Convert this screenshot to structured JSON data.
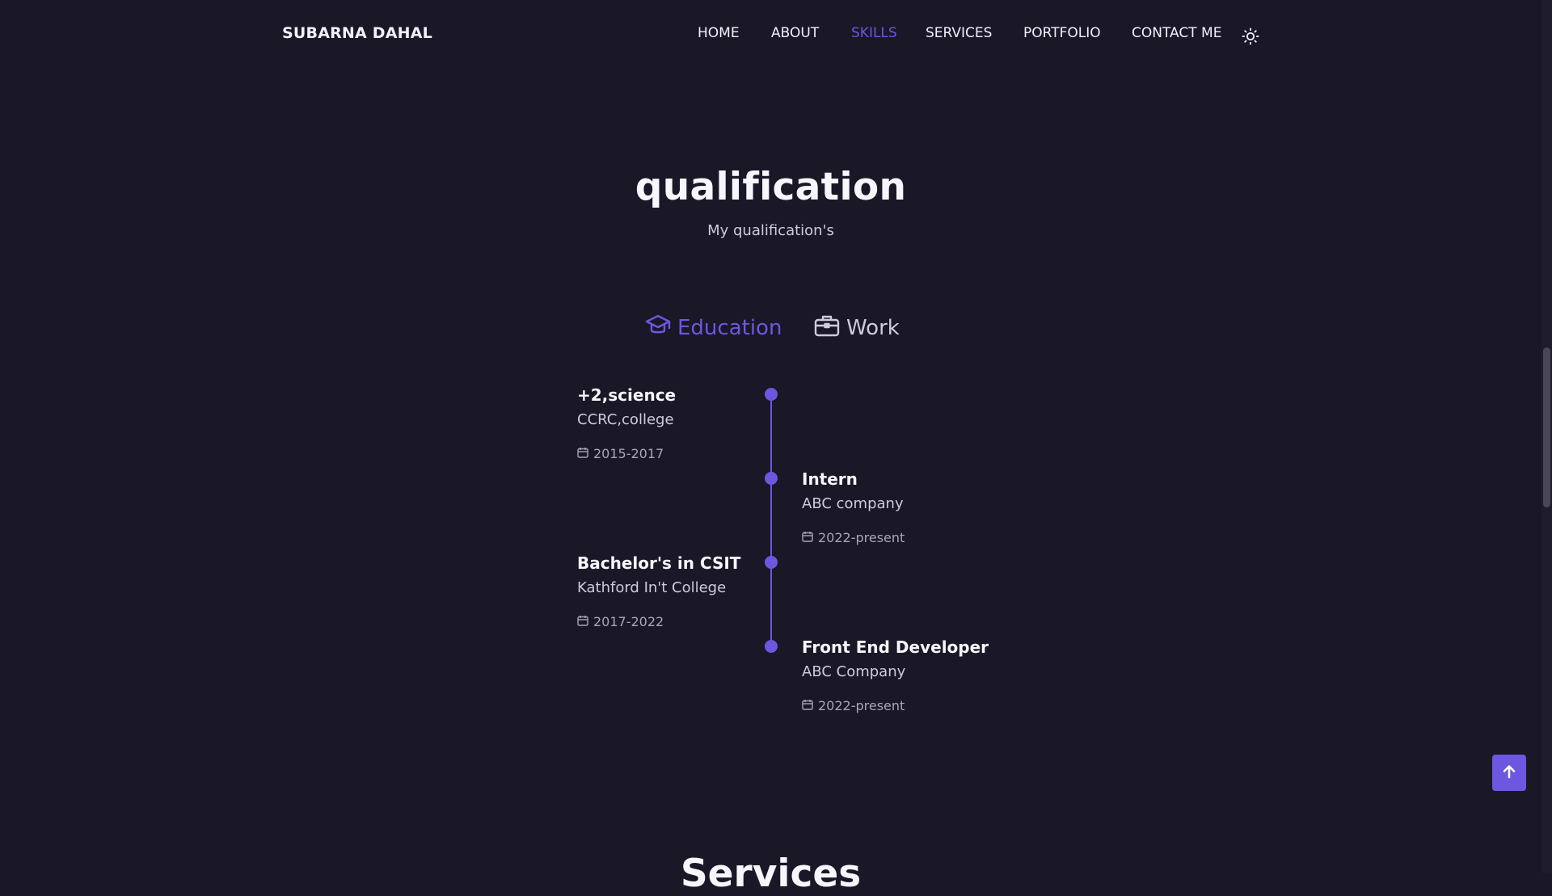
{
  "header": {
    "logo": "SUBARNA DAHAL",
    "nav": [
      {
        "label": "HOME"
      },
      {
        "label": "ABOUT"
      },
      {
        "label": "SKILLS"
      },
      {
        "label": "SERVICES"
      },
      {
        "label": "PORTFOLIO"
      },
      {
        "label": "CONTACT ME"
      }
    ],
    "active_nav": "SKILLS",
    "theme_icon": "sun-icon"
  },
  "qualification": {
    "title": "qualification",
    "subtitle": "My qualification's",
    "tabs": [
      {
        "label": "Education",
        "icon": "graduation-cap-icon",
        "active": true
      },
      {
        "label": "Work",
        "icon": "briefcase-icon",
        "active": false
      }
    ],
    "timeline": [
      {
        "side": "left",
        "title": "+2,science",
        "subtitle": "CCRC,college",
        "date": "2015-2017"
      },
      {
        "side": "right",
        "title": "Intern",
        "subtitle": "ABC company",
        "date": "2022-present"
      },
      {
        "side": "left",
        "title": "Bachelor's in CSIT",
        "subtitle": "Kathford In't College",
        "date": "2017-2022"
      },
      {
        "side": "right",
        "title": "Front End Developer",
        "subtitle": "ABC Company",
        "date": "2022-present"
      }
    ]
  },
  "next_section": {
    "title": "Services"
  },
  "colors": {
    "background": "#1a1727",
    "accent": "#6d57e0",
    "text": "#f2f0fa",
    "muted": "#cfcbdc"
  },
  "scroll_top_icon": "arrow-up-icon"
}
